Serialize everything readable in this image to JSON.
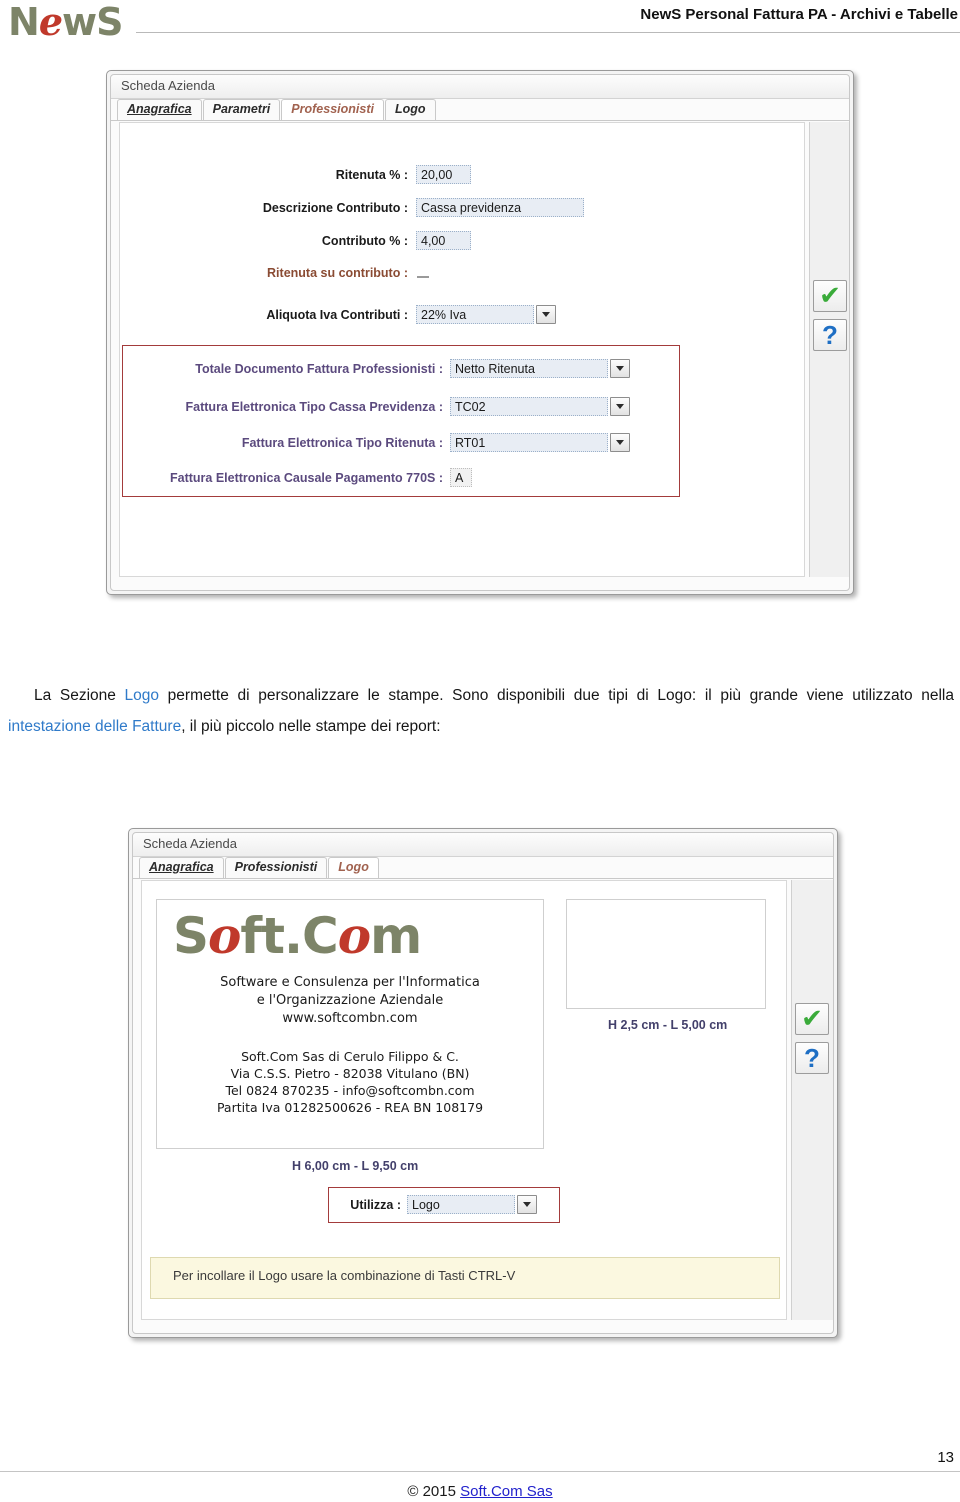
{
  "header": {
    "logo_text_1": "N",
    "logo_text_e": "e",
    "logo_text_2": "wS",
    "title": "NewS Personal Fattura PA -  Archivi e Tabelle"
  },
  "screenshot_one": {
    "window_title": "Scheda Azienda",
    "tabs": [
      {
        "label": "Anagrafica",
        "active": false,
        "accent": false
      },
      {
        "label": "Parametri",
        "active": false,
        "accent": false
      },
      {
        "label": "Professionisti",
        "active": true,
        "accent": true
      },
      {
        "label": "Logo",
        "active": false,
        "accent": false
      }
    ],
    "fields": [
      {
        "label": "Ritenuta % :",
        "value": "20,00",
        "type": "text"
      },
      {
        "label": "Descrizione Contributo :",
        "value": "Cassa previdenza",
        "type": "text"
      },
      {
        "label": "Contributo % :",
        "value": "4,00",
        "type": "text"
      },
      {
        "label": "Ritenuta su contributo :",
        "value": "",
        "type": "blank"
      },
      {
        "label": "Aliquota Iva Contributi :",
        "value": "22% Iva",
        "type": "combo"
      }
    ],
    "group_fields": [
      {
        "label": "Totale Documento Fattura Professionisti :",
        "value": "Netto Ritenuta",
        "type": "combo"
      },
      {
        "label": "Fattura Elettronica Tipo Cassa Previdenza :",
        "value": "TC02",
        "type": "combo"
      },
      {
        "label": "Fattura Elettronica Tipo Ritenuta :",
        "value": "RT01",
        "type": "combo"
      },
      {
        "label": "Fattura Elettronica Causale Pagamento 770S :",
        "value": "A",
        "type": "text"
      }
    ],
    "buttons": {
      "confirm_icon": "check-icon",
      "confirm_glyph": "✔",
      "help_icon": "question-icon",
      "help_glyph": "?"
    }
  },
  "paragraph": {
    "part1": "La Sezione ",
    "hl1": "Logo",
    "part2": " permette di personalizzare le stampe. Sono disponibili due tipi di Logo: il più grande viene utilizzato nella ",
    "hl2": "intestazione delle Fatture",
    "part3": ", il più piccolo nelle stampe dei report:"
  },
  "screenshot_two": {
    "window_title": "Scheda Azienda",
    "tabs": [
      {
        "label": "Anagrafica",
        "active": false,
        "accent": false
      },
      {
        "label": "Professionisti",
        "active": false,
        "accent": false
      },
      {
        "label": "Logo",
        "active": true,
        "accent": true
      }
    ],
    "large_logo": {
      "word_s": "S",
      "word_o1": "o",
      "word_ft": "ft.C",
      "word_o2": "o",
      "word_m": "m",
      "sub_line1": "Software e Consulenza per l'Informatica",
      "sub_line2": "e l'Organizzazione Aziendale",
      "sub_line3": "www.softcombn.com",
      "addr_line1": "Soft.Com Sas di Cerulo Filippo & C.",
      "addr_line2": "Via C.S.S. Pietro - 82038 Vitulano (BN)",
      "addr_line3": "Tel 0824 870235 - info@softcombn.com",
      "addr_line4": "Partita Iva 01282500626 - REA BN 108179",
      "caption": "H 6,00 cm - L 9,50 cm"
    },
    "small_logo": {
      "caption": "H 2,5 cm - L 5,00 cm"
    },
    "utilizza": {
      "label": "Utilizza :",
      "value": "Logo"
    },
    "note": "Per incollare il Logo usare la combinazione di Tasti CTRL-V",
    "buttons": {
      "confirm_icon": "check-icon",
      "confirm_glyph": "✔",
      "help_icon": "question-icon",
      "help_glyph": "?"
    }
  },
  "footer": {
    "page_number": "13",
    "copyright_prefix": "© 2015 ",
    "copyright_link": "Soft.Com Sas"
  }
}
